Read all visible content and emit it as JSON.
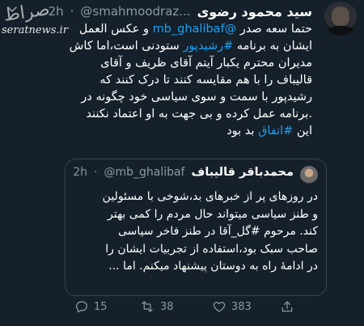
{
  "watermark": {
    "logo_text": "صراط",
    "site": "seratnews.ir"
  },
  "tweet": {
    "display_name": "سید محمود رضوی",
    "handle": "@smahmoodraz...",
    "separator": "·",
    "time": "2h",
    "body_lines": [
      {
        "parts": [
          {
            "text": "حتما سعه صدر ",
            "link": false
          },
          {
            "text": "@mb_ghalibaf",
            "link": true
          },
          {
            "text": " و عکس العمل",
            "link": false
          }
        ]
      },
      {
        "parts": [
          {
            "text": "ایشان به برنامه ",
            "link": false
          },
          {
            "text": "#رشیدپور",
            "link": true
          },
          {
            "text": " ستودنی است،اما کاش",
            "link": false
          }
        ]
      },
      {
        "parts": [
          {
            "text": "مدیران محترم یکبار آیتم آقای ظریف و آقای",
            "link": false
          }
        ]
      },
      {
        "parts": [
          {
            "text": "قالیباف را با هم مقایسه کنند تا درک کنند که",
            "link": false
          }
        ]
      },
      {
        "parts": [
          {
            "text": "رشیدپور با سمت و سوی سیاسی خود چگونه در",
            "link": false
          }
        ]
      },
      {
        "parts": [
          {
            "text": ".برنامه عمل کرده و بی جهت به او اعتماد نکنند",
            "link": false
          }
        ]
      },
      {
        "parts": [
          {
            "text": "این ",
            "link": false
          },
          {
            "text": "#اتفاق",
            "link": true
          },
          {
            "text": " بد بود",
            "link": false
          }
        ]
      }
    ]
  },
  "quoted": {
    "display_name": "محمدباقر قالیباف",
    "handle": "@mb_ghalibaf",
    "separator": "·",
    "time": "2h",
    "body_lines": [
      "در روزهای پر از خبرهای بد،شوخی با مسئولین",
      "و طنز سیاسی میتواند حال مردم را کمی بهتر",
      "کند. مرحوم #گل_آقا در طنز فاخر سیاسی",
      "صاحب سبک بود،استفاده از تجربیات ایشان را",
      "در ادامهٔ راه به دوستان پیشنهاد میکنم. اما ..."
    ]
  },
  "actions": {
    "reply_count": "15",
    "retweet_count": "38",
    "like_count": "383"
  },
  "icons": {
    "reply": "reply-icon",
    "retweet": "retweet-icon",
    "like": "heart-icon",
    "share": "share-icon",
    "menu": "chevron-down-icon"
  },
  "colors": {
    "background": "#15202b",
    "link": "#1da1f2",
    "muted": "#8899a6",
    "border": "#38444d"
  }
}
